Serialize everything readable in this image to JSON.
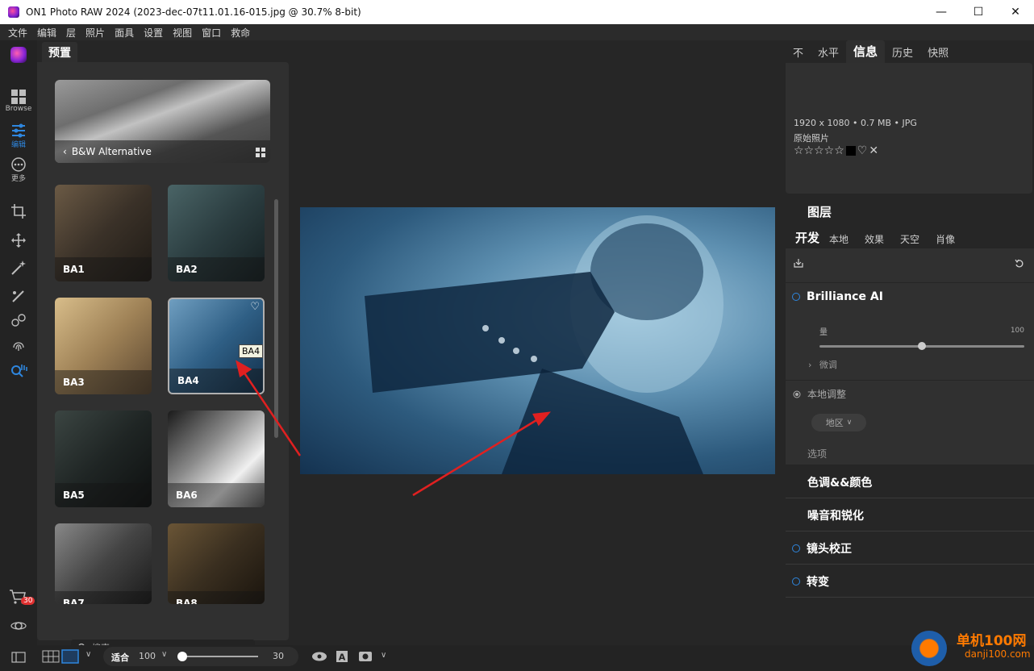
{
  "window": {
    "title": "ON1 Photo RAW 2024 (2023-dec-07t11.01.16-015.jpg @ 30.7% 8-bit)",
    "minimize": "—",
    "maximize": "☐",
    "close": "✕"
  },
  "menu": [
    "文件",
    "编辑",
    "层",
    "照片",
    "面具",
    "设置",
    "视图",
    "窗口",
    "救命"
  ],
  "leftbar": {
    "browse_label": "Browse",
    "edit_label": "编辑",
    "more_label": "更多",
    "cart_badge": "30"
  },
  "presets": {
    "tab_label": "预置",
    "category_label": "B&W Alternative",
    "thumbs": [
      {
        "label": "BA1"
      },
      {
        "label": "BA2"
      },
      {
        "label": "BA3"
      },
      {
        "label": "BA4"
      },
      {
        "label": "BA5"
      },
      {
        "label": "BA6"
      },
      {
        "label": "BA7"
      },
      {
        "label": "BA8"
      }
    ],
    "tooltip": "BA4",
    "search_placeholder": "搜索"
  },
  "right": {
    "tabs": [
      "不",
      "水平",
      "信息",
      "历史",
      "快照"
    ],
    "active_tab": "信息",
    "info": {
      "dimensions": "1920 x 1080 • 0.7 MB • JPG",
      "subtitle": "原始照片",
      "rating_stars": "☆☆☆☆☆"
    },
    "layers_title": "图层",
    "dev_tabs": [
      "开发",
      "本地",
      "效果",
      "天空",
      "肖像"
    ],
    "brilliance": {
      "title": "Brilliance AI",
      "amount_label": "量",
      "amount_value": "100",
      "amount_fraction": 0.5,
      "fine_tune": "微调"
    },
    "local_adjust": "本地调整",
    "region": "地区",
    "options": "选项",
    "sections": [
      "色调&&颜色",
      "噪音和锐化",
      "镜头校正",
      "转变"
    ]
  },
  "bottom": {
    "fit_label": "适合",
    "zoom_value": "100",
    "slider_value": "30"
  },
  "watermark": {
    "text1": "单机100网",
    "text2": "danji100.com"
  }
}
